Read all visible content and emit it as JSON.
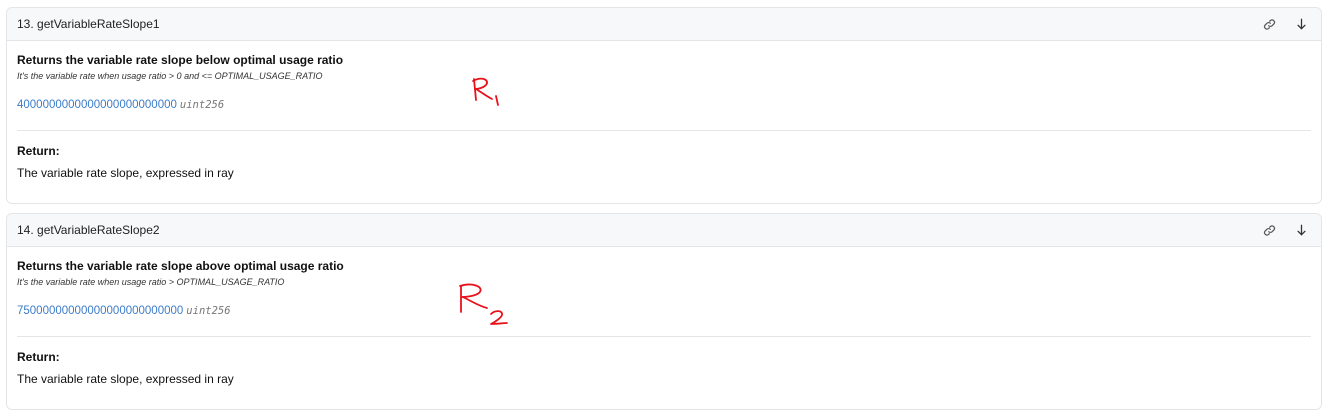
{
  "items": [
    {
      "title": "13. getVariableRateSlope1",
      "description": "Returns the variable rate slope below optimal usage ratio",
      "subtext": "It's the variable rate when usage ratio > 0 and <= OPTIMAL_USAGE_RATIO",
      "value": "4000000000000000000000000",
      "value_type": "uint256",
      "return_label": "Return:",
      "return_desc": "The variable rate slope, expressed in ray",
      "link_icon": "link-icon",
      "expand_icon": "arrow-down-icon",
      "handwritten_note": "R1"
    },
    {
      "title": "14. getVariableRateSlope2",
      "description": "Returns the variable rate slope above optimal usage ratio",
      "subtext": "It's the variable rate when usage ratio > OPTIMAL_USAGE_RATIO",
      "value": "75000000000000000000000000",
      "value_type": "uint256",
      "return_label": "Return:",
      "return_desc": "The variable rate slope, expressed in ray",
      "link_icon": "link-icon",
      "expand_icon": "arrow-down-icon",
      "handwritten_note": "R2"
    }
  ],
  "colors": {
    "value_link": "#3d7cc9",
    "annotation": "#e8121b",
    "header_bg": "#f7f8f9",
    "border": "#e3e5e8"
  }
}
